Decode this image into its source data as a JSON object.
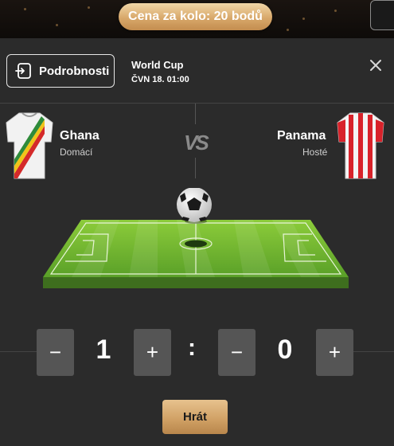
{
  "header": {
    "price_badge": "Cena za kolo: 20 bodů"
  },
  "details": {
    "button_label": "Podrobnosti"
  },
  "event": {
    "name": "World Cup",
    "time": "ČVN 18. 01:00"
  },
  "home": {
    "name": "Ghana",
    "role": "Domácí"
  },
  "away": {
    "name": "Panama",
    "role": "Hosté"
  },
  "vs_label": "VS",
  "score": {
    "home": "1",
    "away": "0",
    "separator": ":",
    "minus": "−",
    "plus": "+"
  },
  "play_label": "Hrát",
  "colors": {
    "gold": "#d8a86a",
    "panel": "#2b2b2b",
    "stepper": "#555555",
    "pitch": "#6fb52c"
  }
}
